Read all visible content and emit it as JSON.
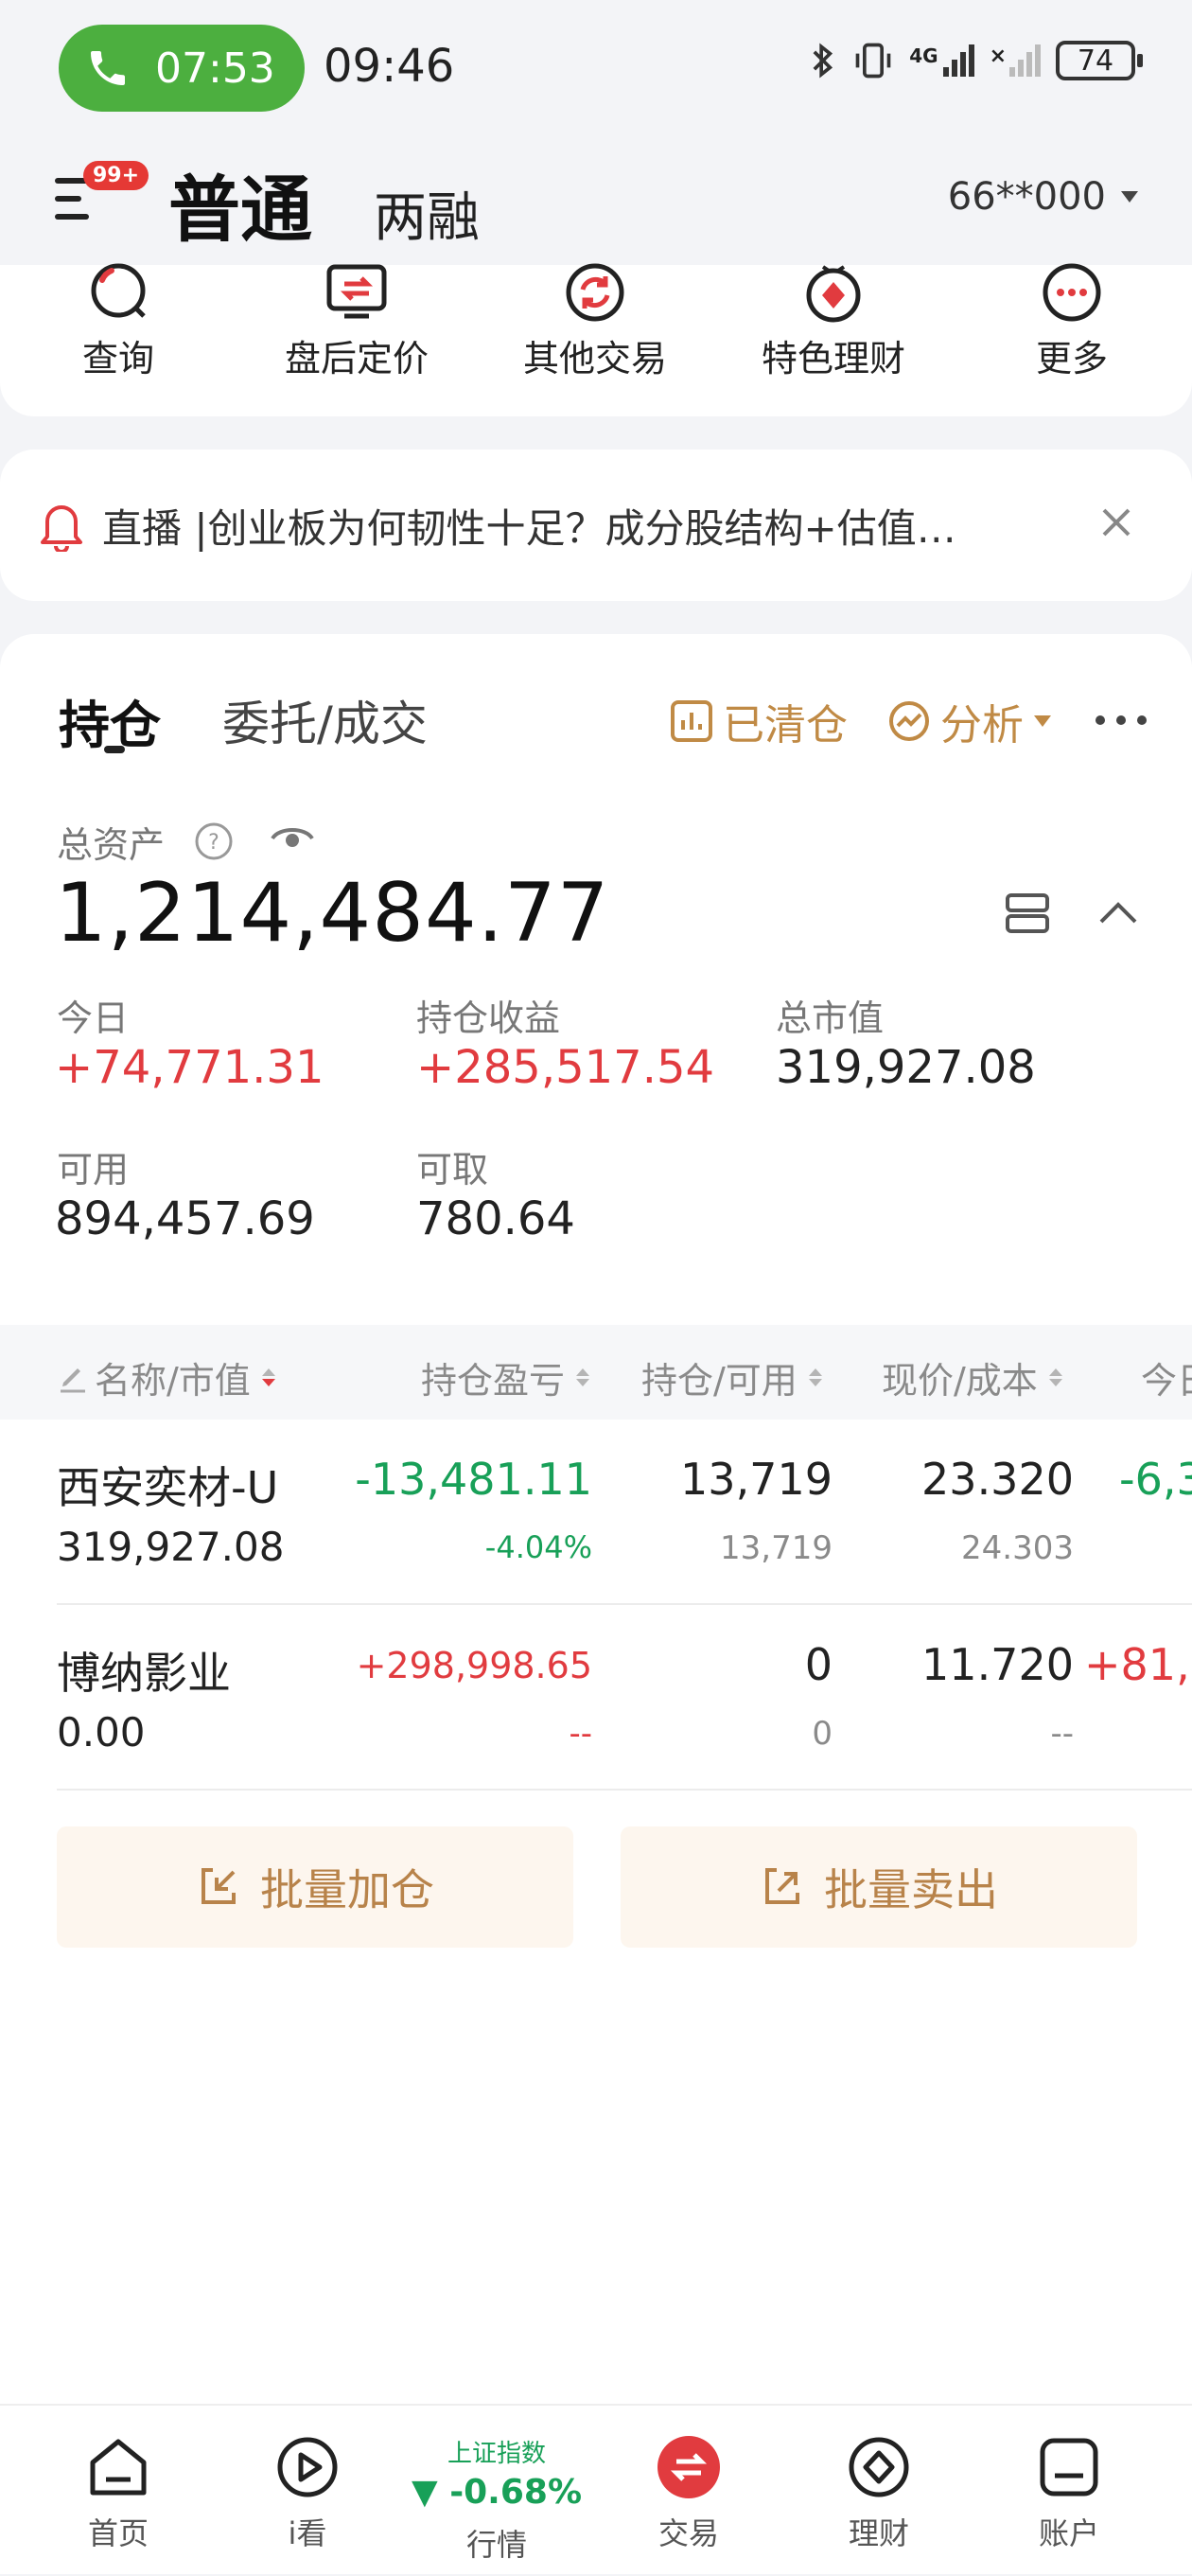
{
  "status_bar": {
    "call_timer": "07:53",
    "clock": "09:46",
    "network": "4G",
    "battery": "74"
  },
  "header": {
    "badge": "99+",
    "account_type_active": "普通",
    "account_type_other": "两融",
    "account_number": "66**000"
  },
  "quick_actions": [
    {
      "label": "查询",
      "icon": "search-icon"
    },
    {
      "label": "盘后定价",
      "icon": "transfer-icon"
    },
    {
      "label": "其他交易",
      "icon": "refresh-icon"
    },
    {
      "label": "特色理财",
      "icon": "diamond-icon"
    },
    {
      "label": "更多",
      "icon": "more-icon"
    }
  ],
  "banner": {
    "text": "直播 |创业板为何韧性十足？成分股结构+估值…"
  },
  "tabs": {
    "positions": "持仓",
    "orders": "委托/成交"
  },
  "tools": {
    "cleared": "已清仓",
    "analysis": "分析"
  },
  "assets": {
    "total_label": "总资产",
    "total_value": "1,214,484.77",
    "today_label": "今日",
    "today_value": "+74,771.31",
    "profit_label": "持仓收益",
    "profit_value": "+285,517.54",
    "market_label": "总市值",
    "market_value": "319,927.08",
    "available_label": "可用",
    "available_value": "894,457.69",
    "withdrawable_label": "可取",
    "withdrawable_value": "780.64"
  },
  "table": {
    "headers": [
      "名称/市值",
      "持仓盈亏",
      "持仓/可用",
      "现价/成本",
      "今日"
    ],
    "rows": [
      {
        "name": "西安奕材-U",
        "market_value": "319,927.08",
        "pnl": "-13,481.11",
        "pnl_pct": "-4.04%",
        "position": "13,719",
        "available": "13,719",
        "price": "23.320",
        "cost": "24.303",
        "today": "-6,3"
      },
      {
        "name": "博纳影业",
        "market_value": "0.00",
        "pnl": "+298,998.65",
        "pnl_pct": "--",
        "position": "0",
        "available": "0",
        "price": "11.720",
        "cost": "--",
        "today": "+81,0"
      }
    ]
  },
  "batch": {
    "add": "批量加仓",
    "sell": "批量卖出"
  },
  "bottom_nav": {
    "home": "首页",
    "watch": "i看",
    "index_name": "上证指数",
    "index_change": "▼ -0.68%",
    "market": "行情",
    "trade": "交易",
    "finance": "理财",
    "account": "账户"
  },
  "colors": {
    "up": "#e13b3f",
    "down": "#18a058",
    "accent_gold": "#c08a45",
    "call_green": "#4caf3f"
  }
}
